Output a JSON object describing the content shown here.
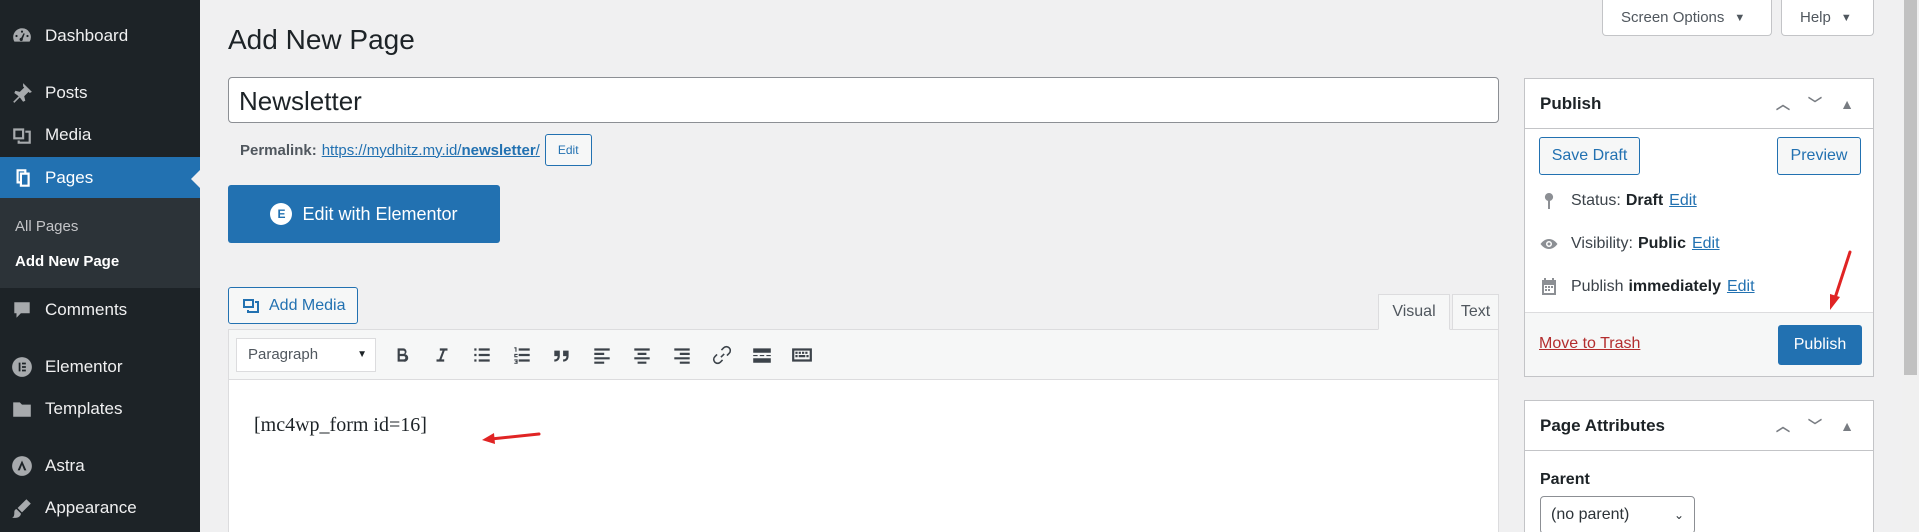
{
  "sidebar": {
    "items": [
      {
        "label": "Dashboard",
        "icon": "dashboard-icon"
      },
      {
        "label": "Posts",
        "icon": "pin-icon"
      },
      {
        "label": "Media",
        "icon": "media-icon"
      },
      {
        "label": "Pages",
        "icon": "page-icon"
      },
      {
        "label": "Comments",
        "icon": "comment-icon"
      },
      {
        "label": "Elementor",
        "icon": "elementor-icon"
      },
      {
        "label": "Templates",
        "icon": "folder-icon"
      },
      {
        "label": "Astra",
        "icon": "astra-icon"
      },
      {
        "label": "Appearance",
        "icon": "brush-icon"
      }
    ],
    "submenu": [
      "All Pages",
      "Add New Page"
    ]
  },
  "header": {
    "screen_options": "Screen Options",
    "help": "Help",
    "title": "Add New Page"
  },
  "editor": {
    "post_title": "Newsletter",
    "permalink_label": "Permalink:",
    "permalink_base": "https://mydhitz.my.id/",
    "permalink_slug": "newsletter",
    "permalink_trail": "/",
    "permalink_edit": "Edit",
    "elementor_button": "Edit with Elementor",
    "add_media": "Add Media",
    "tab_visual": "Visual",
    "tab_text": "Text",
    "format": "Paragraph",
    "content": "[mc4wp_form id=16]"
  },
  "publish": {
    "title": "Publish",
    "save_draft": "Save Draft",
    "preview": "Preview",
    "status_label": "Status:",
    "status_value": "Draft",
    "visibility_label": "Visibility:",
    "visibility_value": "Public",
    "publish_label": "Publish",
    "publish_value": "immediately",
    "edit": "Edit",
    "move_to_trash": "Move to Trash",
    "publish_button": "Publish"
  },
  "page_attributes": {
    "title": "Page Attributes",
    "parent_label": "Parent",
    "parent_value": "(no parent)"
  },
  "colors": {
    "sidebar_bg": "#1d2327",
    "accent": "#2271b1",
    "annotation_arrow": "#e02424"
  }
}
